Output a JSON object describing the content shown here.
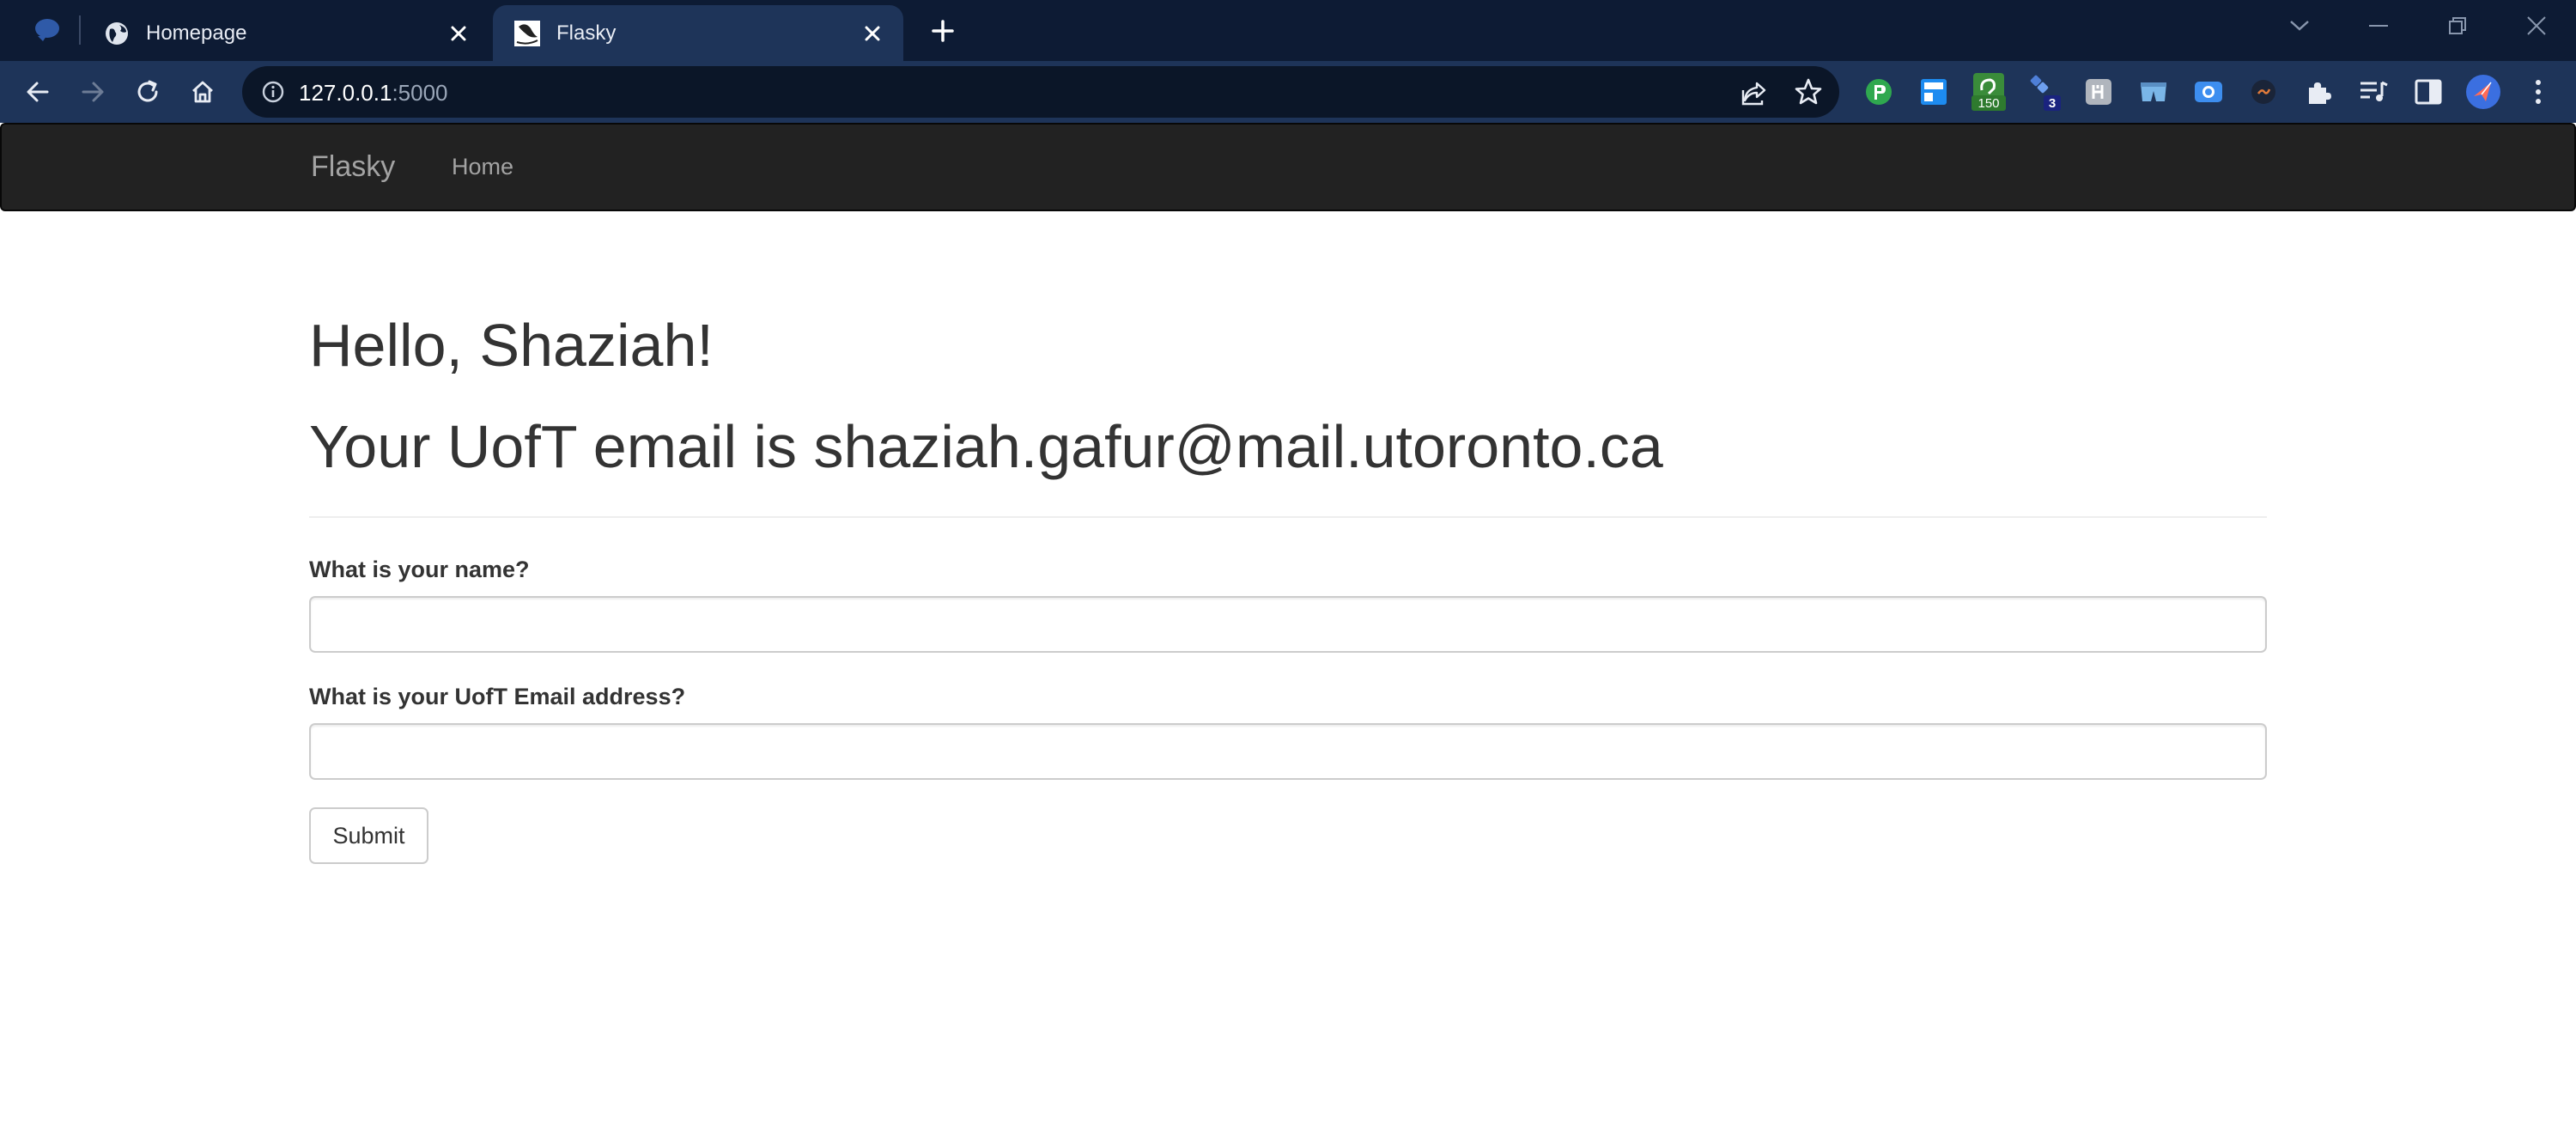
{
  "browser": {
    "tabs": [
      {
        "title": "Homepage",
        "icon": "globe-icon",
        "active": false
      },
      {
        "title": "Flasky",
        "icon": "flask-favicon",
        "active": true
      }
    ],
    "address": {
      "host": "127.0.0.1",
      "port": ":5000"
    },
    "extensions": [
      {
        "name": "extension-green-icon",
        "badge": ""
      },
      {
        "name": "extension-blue-icon",
        "badge": ""
      },
      {
        "name": "extension-counter-icon",
        "badge": "150"
      },
      {
        "name": "extension-dots-icon",
        "badge": "3"
      },
      {
        "name": "extension-grey-icon",
        "badge": ""
      },
      {
        "name": "extension-shorts-icon",
        "badge": ""
      },
      {
        "name": "extension-camera-icon",
        "badge": ""
      },
      {
        "name": "extension-dark-icon",
        "badge": ""
      }
    ]
  },
  "navbar": {
    "brand": "Flasky",
    "links": [
      "Home"
    ]
  },
  "main": {
    "greeting": "Hello, Shaziah!",
    "email_line": "Your UofT email is shaziah.gafur@mail.utoronto.ca"
  },
  "form": {
    "name_label": "What is your name?",
    "name_value": "",
    "email_label": "What is your UofT Email address?",
    "email_value": "",
    "submit_label": "Submit"
  },
  "colors": {
    "tabstrip_bg": "#0d1b34",
    "toolbar_bg": "#1e3459",
    "navbar_bg": "#222222",
    "text": "#333333"
  }
}
